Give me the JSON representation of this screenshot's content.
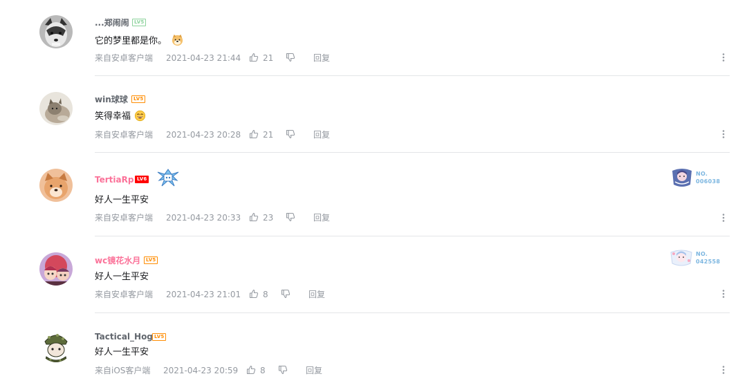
{
  "replies": [
    {
      "username": "...郑闹闹",
      "level": "LV5",
      "level_color": "#8bd29b",
      "content": "它的梦里都是你。",
      "sticker_icon": "doge-emoji-icon",
      "platform": "来自安卓客户端",
      "time": "2021-04-23 21:44",
      "likes": "21",
      "reply_label": "回复"
    },
    {
      "username": "win球球",
      "level": "LV5",
      "level_color": "#ff8c00",
      "content": "笑得幸福",
      "sticker_icon": "laughing-emoji-icon",
      "platform": "来自安卓客户端",
      "time": "2021-04-23 20:28",
      "likes": "21",
      "reply_label": "回复"
    },
    {
      "username": "TertiaRp",
      "level": "LV6",
      "level_color": "#ff0000",
      "content": "好人一生平安",
      "pendant_icon": "ribbon-pendant-icon",
      "nameplate_icon": "fan-badge-icon",
      "nameplate_label": "NO.",
      "nameplate_number": "006038",
      "platform": "来自安卓客户端",
      "time": "2021-04-23 20:33",
      "likes": "23",
      "reply_label": "回复"
    },
    {
      "username": "wc镜花水月",
      "level": "LV5",
      "level_color": "#ff8c00",
      "content": "好人一生平安",
      "nameplate_icon": "fan-badge-icon",
      "nameplate_label": "NO.",
      "nameplate_number": "042558",
      "platform": "来自安卓客户端",
      "time": "2021-04-23 21:01",
      "likes": "8",
      "reply_label": "回复"
    },
    {
      "username": "Tactical_Hog",
      "level": "LV5",
      "level_color": "#ff8c00",
      "content": "好人一生平安",
      "platform": "来自iOS客户端",
      "time": "2021-04-23 20:59",
      "likes": "8",
      "reply_label": "回复"
    }
  ],
  "colors": {
    "vip_name": "#fb7299",
    "normal_name": "#61666d",
    "meta_text": "#9499a0",
    "divider": "#e3e5e7"
  },
  "icons": {
    "like": "thumbs-up-icon",
    "dislike": "thumbs-down-icon",
    "more": "more-vertical-icon"
  }
}
